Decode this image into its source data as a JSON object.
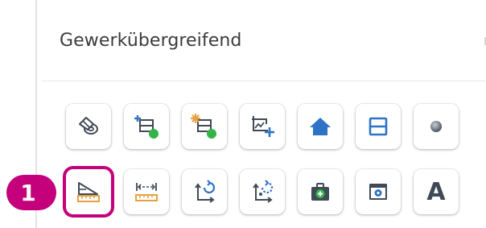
{
  "section": {
    "title": "Gewerkübergreifend"
  },
  "callout": {
    "number": "1"
  },
  "colors": {
    "accent": "#c4007a",
    "icon_dark": "#3f4a56",
    "icon_blue": "#2f73c6",
    "icon_orange": "#e8a040",
    "icon_green": "#34b448"
  },
  "tools": {
    "row1": [
      {
        "icon": "eraser-tape-icon"
      },
      {
        "icon": "add-element-green-icon"
      },
      {
        "icon": "add-element-orange-icon"
      },
      {
        "icon": "region-add-icon"
      },
      {
        "icon": "home-icon"
      },
      {
        "icon": "split-horizontal-icon"
      },
      {
        "icon": "circle-dot-icon"
      }
    ],
    "row2": [
      {
        "icon": "ruler-measure-icon",
        "selected": true
      },
      {
        "icon": "dimension-width-icon"
      },
      {
        "icon": "rotate-axis-icon"
      },
      {
        "icon": "rotate-axis-dotted-icon"
      },
      {
        "icon": "medical-kit-icon"
      },
      {
        "icon": "browser-gear-icon"
      },
      {
        "icon": "text-icon",
        "text": "A"
      }
    ]
  }
}
